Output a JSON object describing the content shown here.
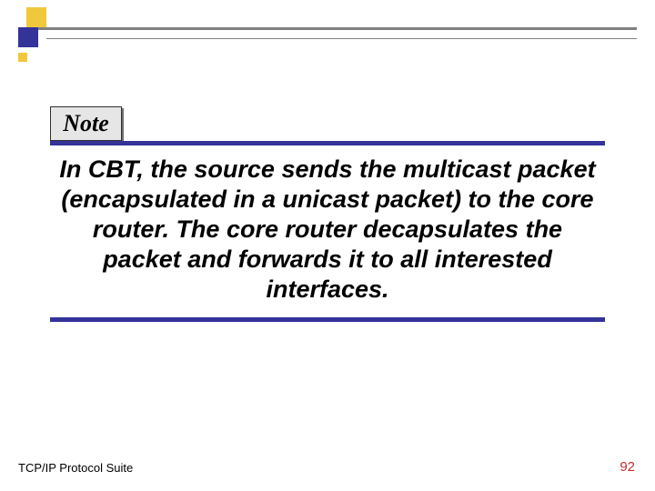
{
  "note_label": "Note",
  "body_text": "In CBT, the source sends the multicast packet (encapsulated in a unicast packet) to the core router. The core router decapsulates the packet and forwards it to all interested interfaces.",
  "footer": {
    "left": "TCP/IP Protocol Suite",
    "right": "92"
  },
  "colors": {
    "accent_blue": "#333399",
    "accent_yellow": "#f0c83c",
    "rule_gray": "#808080",
    "page_number": "#c03030"
  }
}
